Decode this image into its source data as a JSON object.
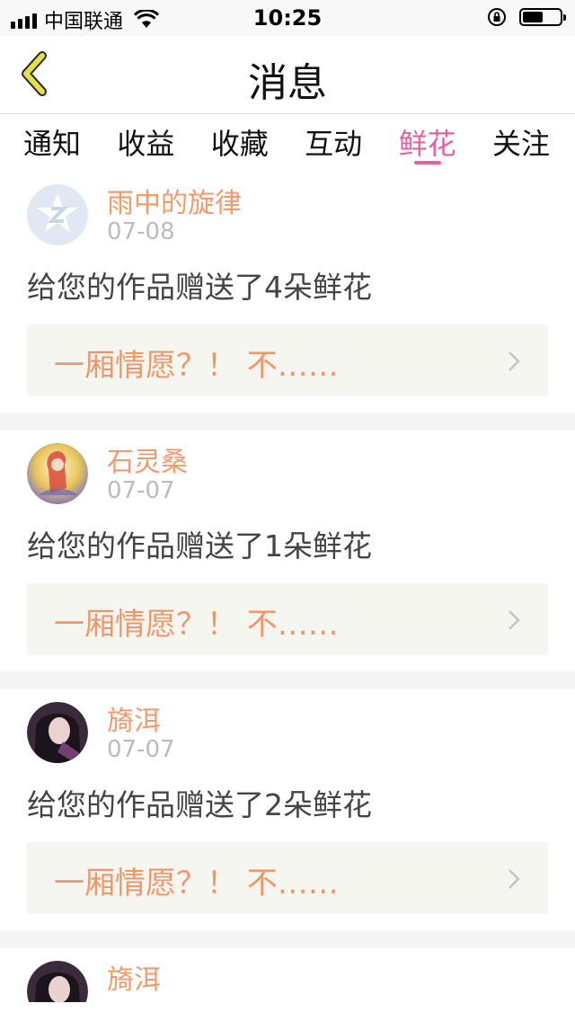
{
  "status_bar": {
    "carrier": "中国联通",
    "time": "10:25",
    "battery_level": 0.55
  },
  "header": {
    "title": "消息",
    "back_icon": "chevron-left-icon"
  },
  "tabs": [
    {
      "label": "通知",
      "active": false
    },
    {
      "label": "收益",
      "active": false
    },
    {
      "label": "收藏",
      "active": false
    },
    {
      "label": "互动",
      "active": false
    },
    {
      "label": "鲜花",
      "active": true
    },
    {
      "label": "关注",
      "active": false
    }
  ],
  "messages": [
    {
      "sender": "雨中的旋律",
      "date": "07-08",
      "text": "给您的作品赠送了4朵鲜花",
      "work_title": "一厢情愿？！ 不……",
      "avatar": "qq-logo-avatar"
    },
    {
      "sender": "石灵桑",
      "date": "07-07",
      "text": "给您的作品赠送了1朵鲜花",
      "work_title": "一厢情愿？！ 不……",
      "avatar": "anime-avatar"
    },
    {
      "sender": "旖洱",
      "date": "07-07",
      "text": "给您的作品赠送了2朵鲜花",
      "work_title": "一厢情愿？！ 不……",
      "avatar": "portrait-avatar"
    },
    {
      "sender": "旖洱",
      "date": "",
      "text": "",
      "work_title": "",
      "avatar": "portrait-avatar"
    }
  ],
  "colors": {
    "accent": "#e5609e",
    "sender_name": "#f39a6c",
    "quote_text": "#f0976a",
    "back_icon": "#e7e045"
  }
}
